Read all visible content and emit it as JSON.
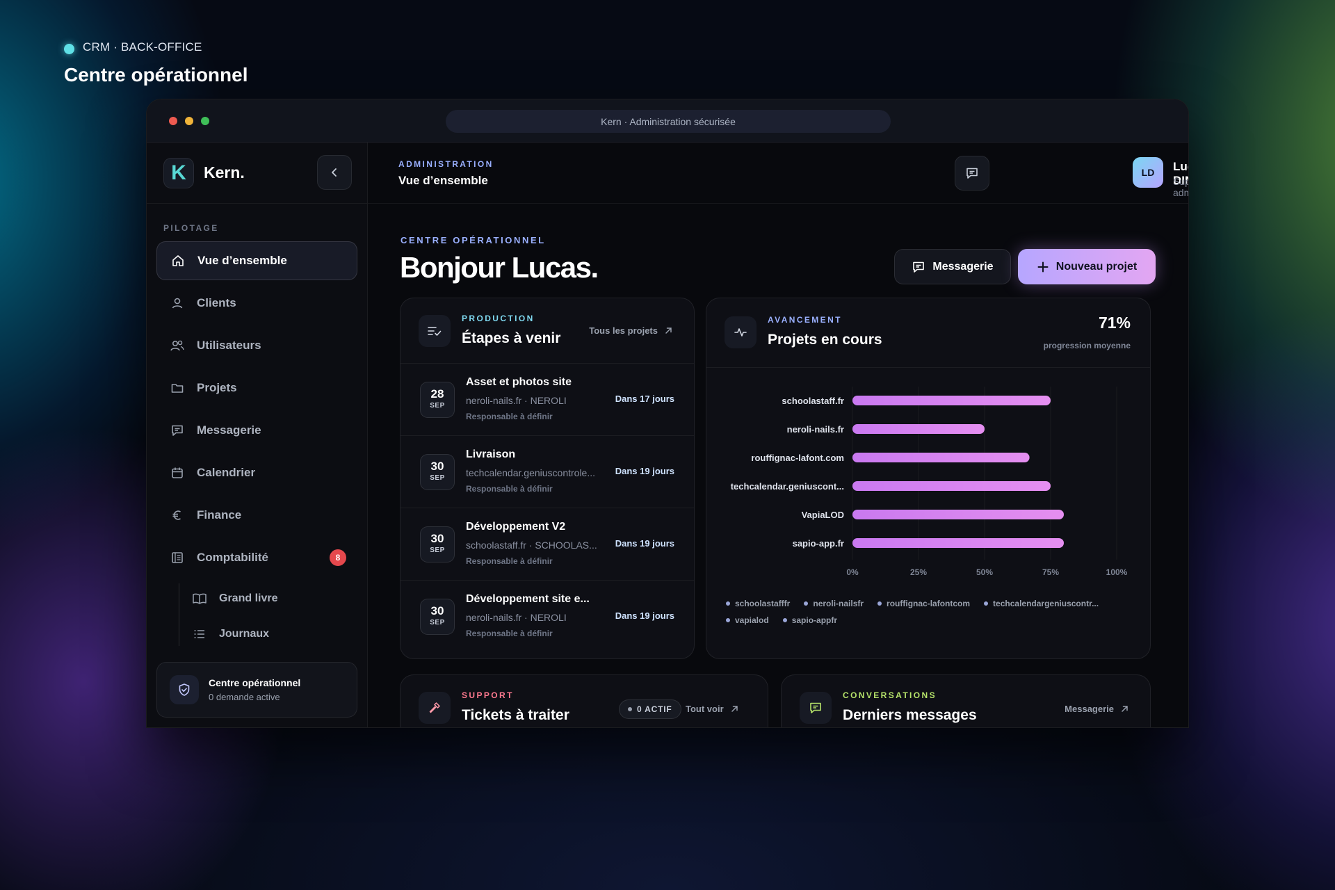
{
  "page": {
    "breadcrumb": "CRM · BACK-OFFICE",
    "title": "Centre opérationnel"
  },
  "browser": {
    "url_title": "Kern · Administration sécurisée"
  },
  "brand": {
    "logo_letter": "K",
    "name": "Kern."
  },
  "sidebar": {
    "section": "PILOTAGE",
    "items": [
      {
        "label": "Vue d’ensemble",
        "icon": "home-icon",
        "active": true
      },
      {
        "label": "Clients",
        "icon": "user-icon"
      },
      {
        "label": "Utilisateurs",
        "icon": "users-icon"
      },
      {
        "label": "Projets",
        "icon": "folder-icon"
      },
      {
        "label": "Messagerie",
        "icon": "message-icon"
      },
      {
        "label": "Calendrier",
        "icon": "calendar-icon"
      },
      {
        "label": "Finance",
        "icon": "euro-icon"
      },
      {
        "label": "Comptabilité",
        "icon": "ledger-icon",
        "badge": "8"
      }
    ],
    "subitems": [
      {
        "label": "Grand livre",
        "icon": "book-icon"
      },
      {
        "label": "Journaux",
        "icon": "list-icon"
      }
    ],
    "status_card": {
      "title": "Centre opérationnel",
      "subtitle": "0 demande active"
    }
  },
  "topbar": {
    "eyebrow": "ADMINISTRATION",
    "title": "Vue d’ensemble",
    "user": {
      "initials": "LD",
      "name": "Lucas DINNICHERT",
      "role": "Super-administrateur"
    }
  },
  "hero": {
    "eyebrow": "CENTRE OPÉRATIONNEL",
    "greeting": "Bonjour Lucas.",
    "btn_messages": "Messagerie",
    "btn_new_project": "Nouveau projet"
  },
  "production": {
    "eyebrow": "PRODUCTION",
    "title": "Étapes à venir",
    "link": "Tous les projets",
    "events": [
      {
        "day": "28",
        "month": "SEP",
        "title": "Asset et photos site",
        "meta": "neroli-nails.fr · NEROLI",
        "resp": "Responsable à définir",
        "due": "Dans 17 jours"
      },
      {
        "day": "30",
        "month": "SEP",
        "title": "Livraison",
        "meta": "techcalendar.geniuscontrole...",
        "resp": "Responsable à définir",
        "due": "Dans 19 jours"
      },
      {
        "day": "30",
        "month": "SEP",
        "title": "Développement V2",
        "meta": "schoolastaff.fr · SCHOOLAS...",
        "resp": "Responsable à définir",
        "due": "Dans 19 jours"
      },
      {
        "day": "30",
        "month": "SEP",
        "title": "Développement site e...",
        "meta": "neroli-nails.fr · NEROLI",
        "resp": "Responsable à définir",
        "due": "Dans 19 jours"
      }
    ]
  },
  "progress": {
    "eyebrow": "AVANCEMENT",
    "title": "Projets en cours",
    "percent": "71%",
    "percent_label": "progression moyenne",
    "legend": [
      "schoolastafffr",
      "neroli-nailsfr",
      "rouffignac-lafontcom",
      "techcalendargeniuscontr...",
      "vapialod",
      "sapio-appfr"
    ]
  },
  "chart_data": {
    "type": "bar",
    "orientation": "horizontal",
    "categories": [
      "schoolastaff.fr",
      "neroli-nails.fr",
      "rouffignac-lafont.com",
      "techcalendar.geniuscont...",
      "VapiaLOD",
      "sapio-app.fr"
    ],
    "values": [
      75,
      50,
      67,
      75,
      80,
      80
    ],
    "xlim": [
      0,
      100
    ],
    "xticks": [
      "0%",
      "25%",
      "50%",
      "75%",
      "100%"
    ],
    "grid": true,
    "bar_color_start": "#c979f0",
    "bar_color_end": "#e58ff0"
  },
  "support": {
    "eyebrow": "SUPPORT",
    "title": "Tickets à traiter",
    "pill": "0 ACTIF",
    "link": "Tout voir"
  },
  "conversations": {
    "eyebrow": "CONVERSATIONS",
    "title": "Derniers messages",
    "link": "Messagerie"
  },
  "colors": {
    "accent": "#9ab0ff",
    "support_accent": "#ff7a90",
    "conversation_accent": "#b6e36a",
    "production_accent": "#7fd9f0",
    "badge": "#e5484d"
  }
}
